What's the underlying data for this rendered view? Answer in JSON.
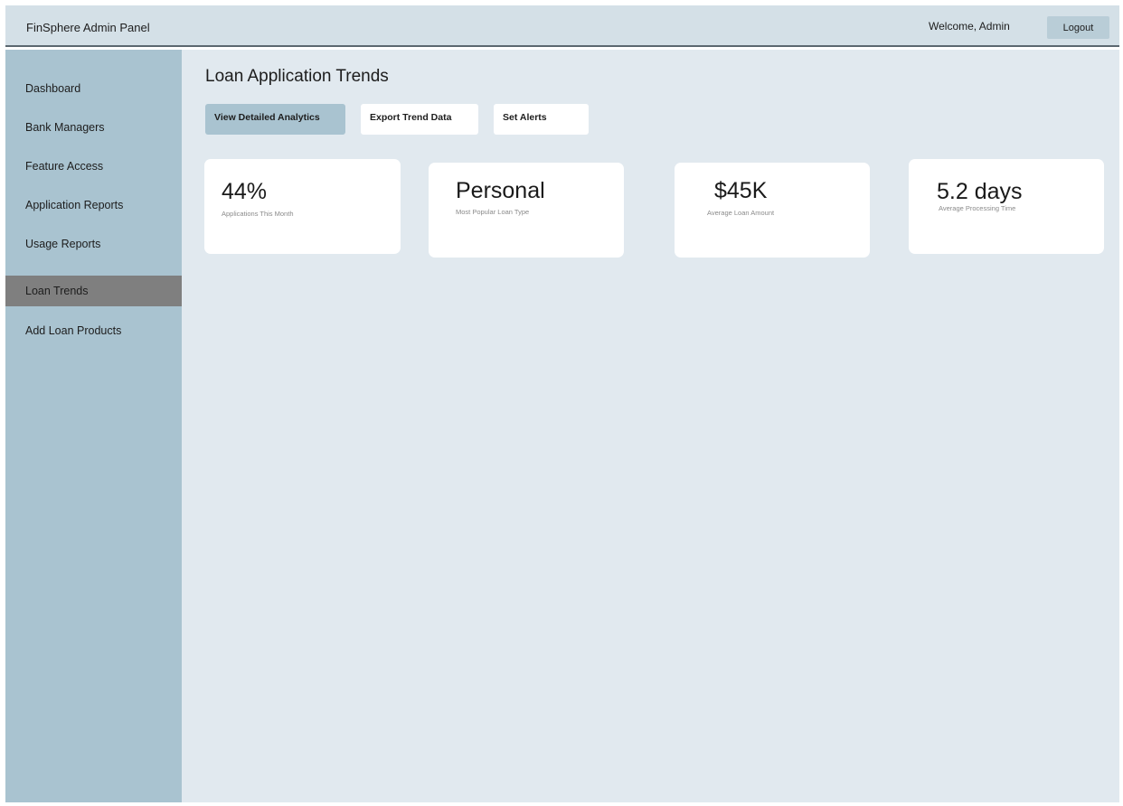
{
  "header": {
    "title": "FinSphere Admin Panel",
    "welcome": "Welcome, Admin",
    "logout_label": "Logout"
  },
  "sidebar": {
    "items": [
      {
        "label": "Dashboard"
      },
      {
        "label": "Bank Managers"
      },
      {
        "label": "Feature Access"
      },
      {
        "label": "Application Reports"
      },
      {
        "label": "Usage Reports"
      },
      {
        "label": "Loan Trends",
        "active": true
      },
      {
        "label": "Add Loan Products"
      }
    ]
  },
  "main": {
    "title": "Loan Application Trends",
    "actions": [
      {
        "label": "View Detailed Analytics",
        "active": true
      },
      {
        "label": "Export Trend Data"
      },
      {
        "label": "Set Alerts"
      }
    ],
    "stats": [
      {
        "value": "44%",
        "label": "Applications This Month"
      },
      {
        "value": "Personal",
        "label": "Most Popular Loan Type"
      },
      {
        "value": "$45K",
        "label": "Average Loan Amount"
      },
      {
        "value": "5.2 days",
        "label": "Average Processing Time"
      }
    ]
  },
  "colors": {
    "header_bg": "#d4e0e7",
    "sidebar_bg": "#a9c3d0",
    "sidebar_active": "#7f7f7f",
    "main_bg": "#e1e9ef",
    "primary_button": "#a9c3d0",
    "card_bg": "#ffffff"
  }
}
